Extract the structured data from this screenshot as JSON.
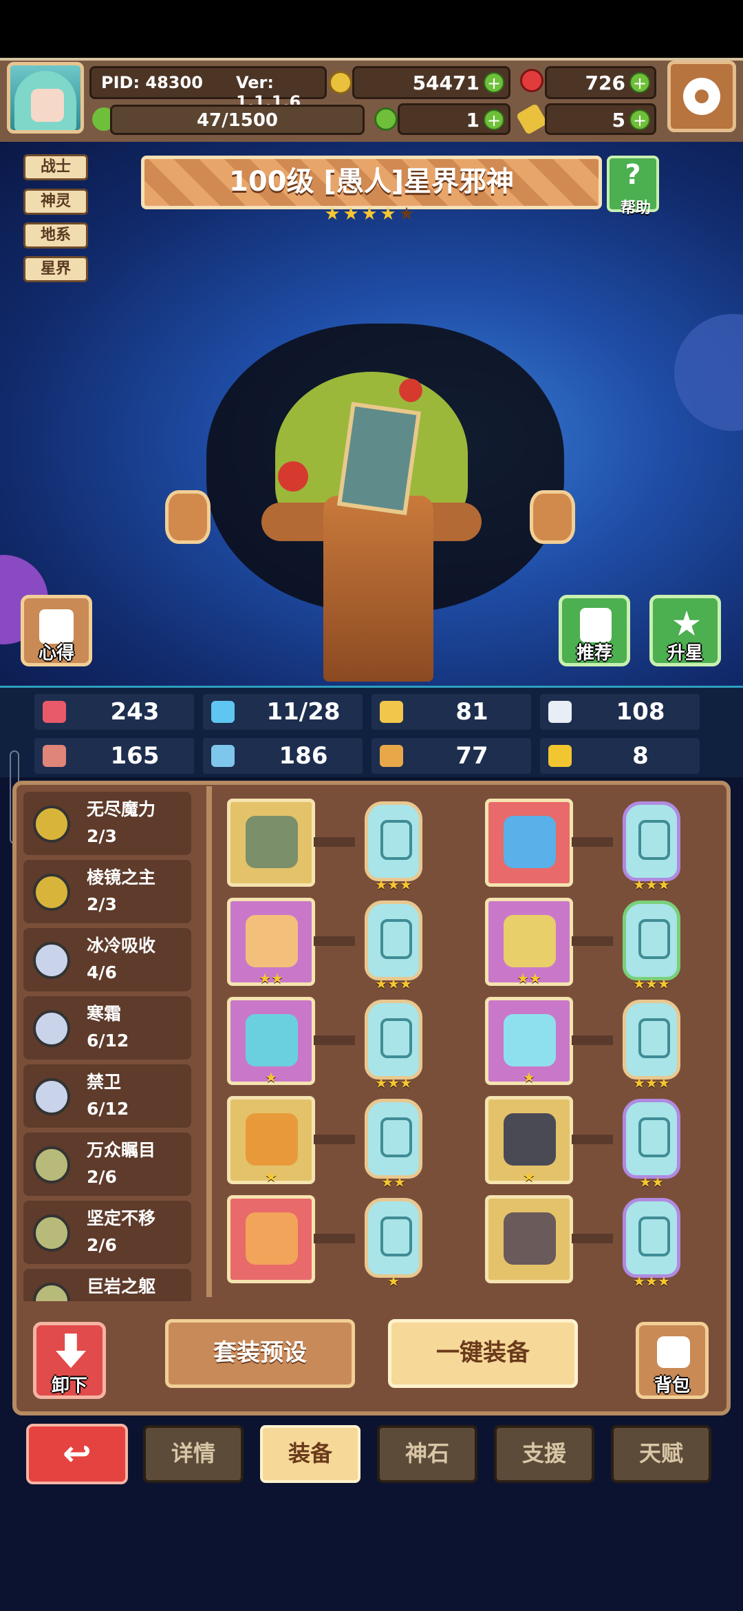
{
  "header": {
    "pid": "PID: 48300",
    "version": "Ver: 1.1.1.6",
    "gold": "54471",
    "gems": "726",
    "exp": "47/1500",
    "clover": "1",
    "keys": "5"
  },
  "tags": [
    "战士",
    "神灵",
    "地系",
    "星界"
  ],
  "hero": {
    "title": "100级  [愚人]星界邪神",
    "stars_filled": 4,
    "stars_total": 5
  },
  "buttons": {
    "help": "帮助",
    "insight": "心得",
    "recommend": "推荐",
    "star_up": "升星",
    "unequip": "卸下",
    "preset": "套装预设",
    "one_click": "一键装备",
    "bag": "背包"
  },
  "stats": [
    {
      "icon": "heart-icon",
      "value": "243",
      "color": "#e85a6a"
    },
    {
      "icon": "drop-icon",
      "value": "11/28",
      "color": "#5ec6f0"
    },
    {
      "icon": "shield-icon",
      "value": "81",
      "color": "#f1c64a"
    },
    {
      "icon": "wing-icon",
      "value": "108",
      "color": "#e8eef5"
    },
    {
      "icon": "fist-icon",
      "value": "165",
      "color": "#e0857a"
    },
    {
      "icon": "book-icon",
      "value": "186",
      "color": "#7fc6ec"
    },
    {
      "icon": "scroll-icon",
      "value": "77",
      "color": "#e8a84a"
    },
    {
      "icon": "horseshoe-icon",
      "value": "8",
      "color": "#f1c631"
    }
  ],
  "sets": [
    {
      "name": "无尽魔力",
      "count": "2/3",
      "color": "#d9b43a"
    },
    {
      "name": "棱镜之主",
      "count": "2/3",
      "color": "#d9b43a"
    },
    {
      "name": "冰冷吸收",
      "count": "4/6",
      "color": "#c9d3ea"
    },
    {
      "name": "寒霜",
      "count": "6/12",
      "color": "#c9d3ea"
    },
    {
      "name": "禁卫",
      "count": "6/12",
      "color": "#c9d3ea"
    },
    {
      "name": "万众瞩目",
      "count": "2/6",
      "color": "#b8ba7a"
    },
    {
      "name": "坚定不移",
      "count": "2/6",
      "color": "#b8ba7a"
    },
    {
      "name": "巨岩之躯",
      "count": "",
      "color": "#b8ba7a"
    }
  ],
  "equipment": [
    {
      "slot_bg": "#e4c26a",
      "gem": "#7a8f6a",
      "item_stars": "",
      "rune_stars": "★★★",
      "rune_border": "#e8c890"
    },
    {
      "slot_bg": "#e86a6a",
      "gem": "#5ab0e8",
      "item_stars": "",
      "rune_stars": "★★★",
      "rune_border": "#b08ae0"
    },
    {
      "slot_bg": "#c978c9",
      "gem": "#f2c07a",
      "item_stars": "★★",
      "rune_stars": "★★★",
      "rune_border": "#e8c890"
    },
    {
      "slot_bg": "#c978c9",
      "gem": "#e8cf6a",
      "item_stars": "★★",
      "rune_stars": "★★★",
      "rune_border": "#7ad07a"
    },
    {
      "slot_bg": "#c978c9",
      "gem": "#6ad0e0",
      "item_stars": "★",
      "rune_stars": "★★★",
      "rune_border": "#e8c890"
    },
    {
      "slot_bg": "#c978c9",
      "gem": "#8fe0ee",
      "item_stars": "★",
      "rune_stars": "★★★",
      "rune_border": "#e8c890"
    },
    {
      "slot_bg": "#e4c26a",
      "gem": "#e89a3a",
      "item_stars": "★",
      "rune_stars": "★★",
      "rune_border": "#e8c890"
    },
    {
      "slot_bg": "#e4c26a",
      "gem": "#4a4a55",
      "item_stars": "★",
      "rune_stars": "★★",
      "rune_border": "#b08ae0"
    },
    {
      "slot_bg": "#e86a6a",
      "gem": "#f2a45a",
      "item_stars": "",
      "rune_stars": "★",
      "rune_border": "#e8c890"
    },
    {
      "slot_bg": "#e4c26a",
      "gem": "#6a5a5a",
      "item_stars": "",
      "rune_stars": "★★★",
      "rune_border": "#b08ae0"
    }
  ],
  "tabs": [
    "详情",
    "装备",
    "神石",
    "支援",
    "天赋"
  ],
  "active_tab": "装备"
}
